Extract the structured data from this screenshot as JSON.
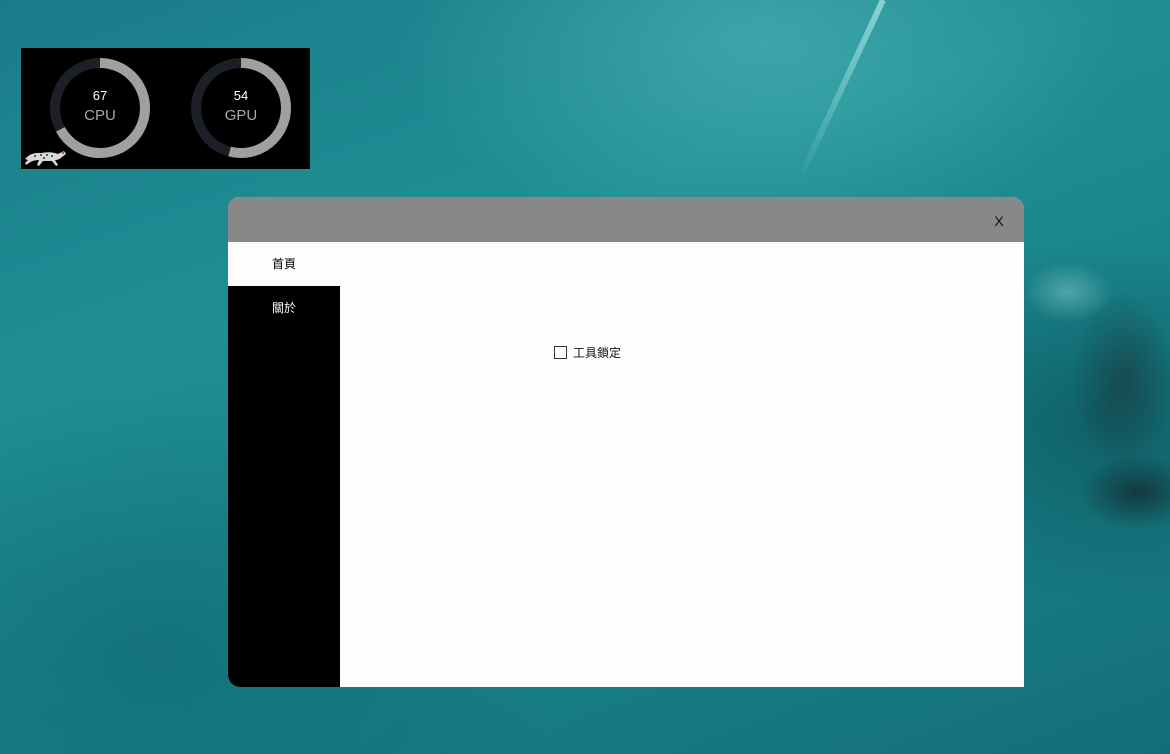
{
  "desktop": {
    "wallpaper_colors": [
      "#1a7c89",
      "#1f8f95",
      "#146e78"
    ]
  },
  "hardware_monitor": {
    "gauges": [
      {
        "label": "CPU",
        "value": "67",
        "percent": 67
      },
      {
        "label": "GPU",
        "value": "54",
        "percent": 54
      }
    ],
    "ring_color": "#a0a0a0",
    "track_color": "#1c1f26",
    "logo_icon": "cheetah-icon"
  },
  "window": {
    "title": "",
    "close_label": "X",
    "titlebar_color": "#888888",
    "sidebar": {
      "items": [
        {
          "label": "首頁",
          "active": true
        },
        {
          "label": "關於",
          "active": false
        }
      ]
    },
    "main": {
      "tool_lock_checkbox": {
        "label": "工具鎖定",
        "checked": false
      }
    }
  }
}
